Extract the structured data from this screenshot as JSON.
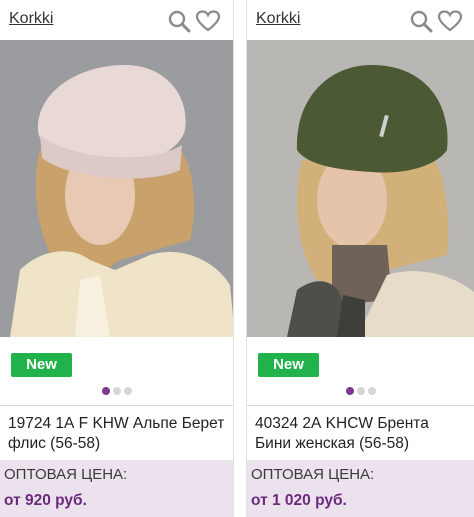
{
  "products": [
    {
      "brand": "Korkki",
      "badge": "New",
      "title": "19724 1А F KHW Альпе Берет флис (56-58)",
      "price_label": "ОПТОВАЯ ЦЕНА:",
      "price": "от 920 руб.",
      "hat_color": "#e9d9d6",
      "active_dot": 0,
      "dots": 3
    },
    {
      "brand": "Korkki",
      "badge": "New",
      "title": "40324 2А KHCW Брента Бини женская (56-58)",
      "price_label": "ОПТОВАЯ ЦЕНА:",
      "price": "от 1 020 руб.",
      "hat_color": "#4b5a35",
      "active_dot": 0,
      "dots": 3
    }
  ],
  "icons": [
    "search-icon",
    "heart-icon"
  ]
}
